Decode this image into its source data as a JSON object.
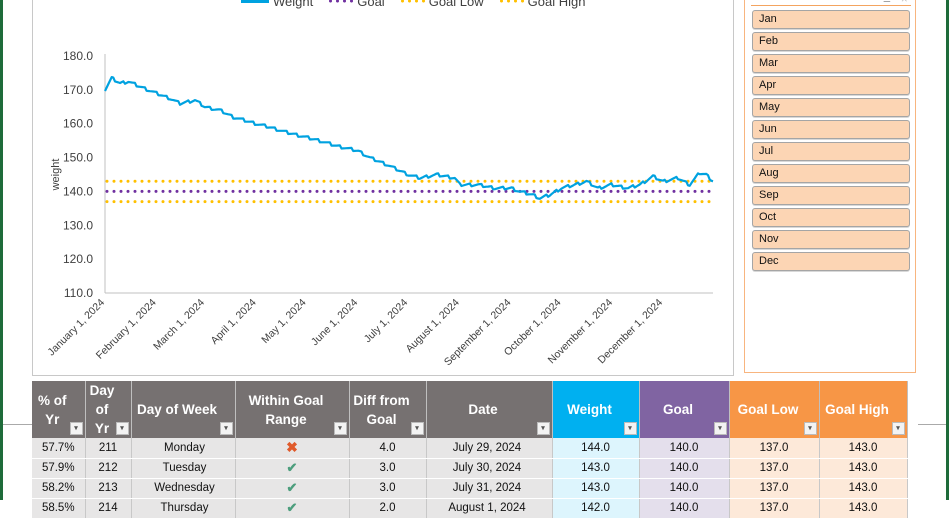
{
  "chart": {
    "legend": [
      {
        "label": "Weight",
        "style": "solid",
        "color": "#00a2e0"
      },
      {
        "label": "Goal",
        "style": "dotted",
        "color": "#7030a0"
      },
      {
        "label": "Goal Low",
        "style": "dotted",
        "color": "#ffc000"
      },
      {
        "label": "Goal High",
        "style": "dotted",
        "color": "#ffc000"
      }
    ]
  },
  "chart_data": {
    "type": "line",
    "title": "",
    "xlabel": "",
    "ylabel": "weight",
    "ylim": [
      110,
      180
    ],
    "yticks": [
      "110.0",
      "120.0",
      "130.0",
      "140.0",
      "150.0",
      "160.0",
      "170.0",
      "180.0"
    ],
    "xticks": [
      "January 1, 2024",
      "February 1, 2024",
      "March 1, 2024",
      "April 1, 2024",
      "May 1, 2024",
      "June 1, 2024",
      "July 1, 2024",
      "August 1, 2024",
      "September 1, 2024",
      "October 1, 2024",
      "November 1, 2024",
      "December 1, 2024"
    ],
    "x_day_of_year": [
      1,
      5,
      10,
      15,
      22,
      32,
      40,
      46,
      55,
      61,
      70,
      78,
      92,
      100,
      110,
      122,
      130,
      140,
      153,
      160,
      170,
      183,
      190,
      200,
      211,
      214,
      225,
      235,
      245,
      250,
      258,
      262,
      268,
      275,
      283,
      290,
      297,
      305,
      315,
      322,
      330,
      336,
      345,
      352,
      358,
      362,
      366
    ],
    "series": [
      {
        "name": "Weight",
        "values": [
          170,
          173.5,
          172,
          172.5,
          171,
          169,
          167.5,
          166,
          167,
          165,
          164,
          162,
          160,
          159,
          157.5,
          156,
          155,
          153.5,
          152,
          150,
          148,
          145,
          144,
          145,
          144,
          142,
          142,
          141,
          141,
          140,
          139,
          138,
          139,
          141,
          142,
          143,
          141,
          142,
          141,
          142,
          144.5,
          143,
          144,
          142,
          145.5,
          145,
          143
        ]
      },
      {
        "name": "Goal",
        "values": [
          140,
          140
        ]
      },
      {
        "name": "Goal Low",
        "values": [
          137,
          137
        ]
      },
      {
        "name": "Goal High",
        "values": [
          143,
          143
        ]
      }
    ],
    "legend_position": "top"
  },
  "slicer": {
    "items": [
      "Jan",
      "Feb",
      "Mar",
      "Apr",
      "May",
      "Jun",
      "Jul",
      "Aug",
      "Sep",
      "Oct",
      "Nov",
      "Dec"
    ]
  },
  "table": {
    "headers": [
      {
        "label": "% of Yr",
        "color": "gray"
      },
      {
        "label": "Day of Yr",
        "color": "gray"
      },
      {
        "label": "Day of Week",
        "color": "gray"
      },
      {
        "label": "Within Goal Range",
        "color": "gray"
      },
      {
        "label": "Diff from Goal",
        "color": "gray"
      },
      {
        "label": "Date",
        "color": "gray"
      },
      {
        "label": "Weight",
        "color": "blue"
      },
      {
        "label": "Goal",
        "color": "purple"
      },
      {
        "label": "Goal Low",
        "color": "orange"
      },
      {
        "label": "Goal High",
        "color": "orange"
      }
    ],
    "rows": [
      {
        "pct": "57.7%",
        "doy": "211",
        "dow": "Monday",
        "within": "no",
        "diff": "4.0",
        "date": "July 29, 2024",
        "weight": "144.0",
        "goal": "140.0",
        "low": "137.0",
        "high": "143.0"
      },
      {
        "pct": "57.9%",
        "doy": "212",
        "dow": "Tuesday",
        "within": "yes",
        "diff": "3.0",
        "date": "July 30, 2024",
        "weight": "143.0",
        "goal": "140.0",
        "low": "137.0",
        "high": "143.0"
      },
      {
        "pct": "58.2%",
        "doy": "213",
        "dow": "Wednesday",
        "within": "yes",
        "diff": "3.0",
        "date": "July 31, 2024",
        "weight": "143.0",
        "goal": "140.0",
        "low": "137.0",
        "high": "143.0"
      },
      {
        "pct": "58.5%",
        "doy": "214",
        "dow": "Thursday",
        "within": "yes",
        "diff": "2.0",
        "date": "August 1, 2024",
        "weight": "142.0",
        "goal": "140.0",
        "low": "137.0",
        "high": "143.0"
      }
    ],
    "icons": {
      "yes": "✔",
      "no": "✖"
    },
    "filter_icon": "▾"
  }
}
